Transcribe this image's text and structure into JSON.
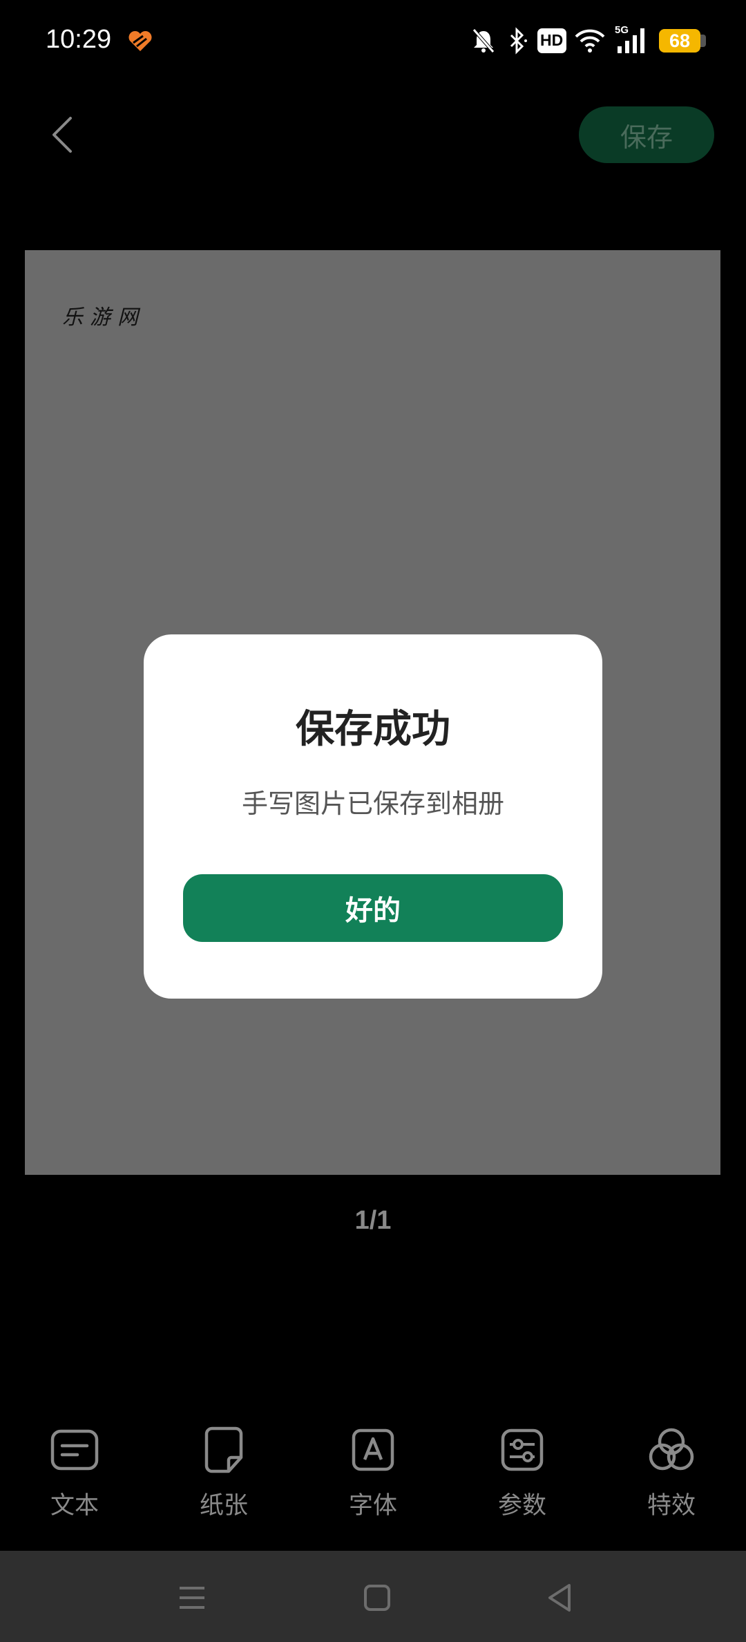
{
  "status_bar": {
    "time": "10:29",
    "hd_label": "HD",
    "hd_sub": "1",
    "network": "5G",
    "battery": "68",
    "colors": {
      "battery": "#f5b700",
      "app_icon": "#f07b28"
    }
  },
  "header": {
    "back_icon": "chevron-left-icon",
    "save_label": "保存"
  },
  "canvas": {
    "text": "乐游网",
    "page_indicator": "1/1"
  },
  "dialog": {
    "title": "保存成功",
    "message": "手写图片已保存到相册",
    "ok_label": "好的",
    "colors": {
      "primary": "#128158"
    }
  },
  "toolbar": {
    "items": [
      {
        "label": "文本",
        "icon": "text-icon"
      },
      {
        "label": "纸张",
        "icon": "paper-icon"
      },
      {
        "label": "字体",
        "icon": "font-icon"
      },
      {
        "label": "参数",
        "icon": "settings-sliders-icon"
      },
      {
        "label": "特效",
        "icon": "effects-icon"
      }
    ]
  },
  "nav_bar": {
    "icons": [
      "menu-icon",
      "home-square-icon",
      "back-triangle-icon"
    ]
  }
}
